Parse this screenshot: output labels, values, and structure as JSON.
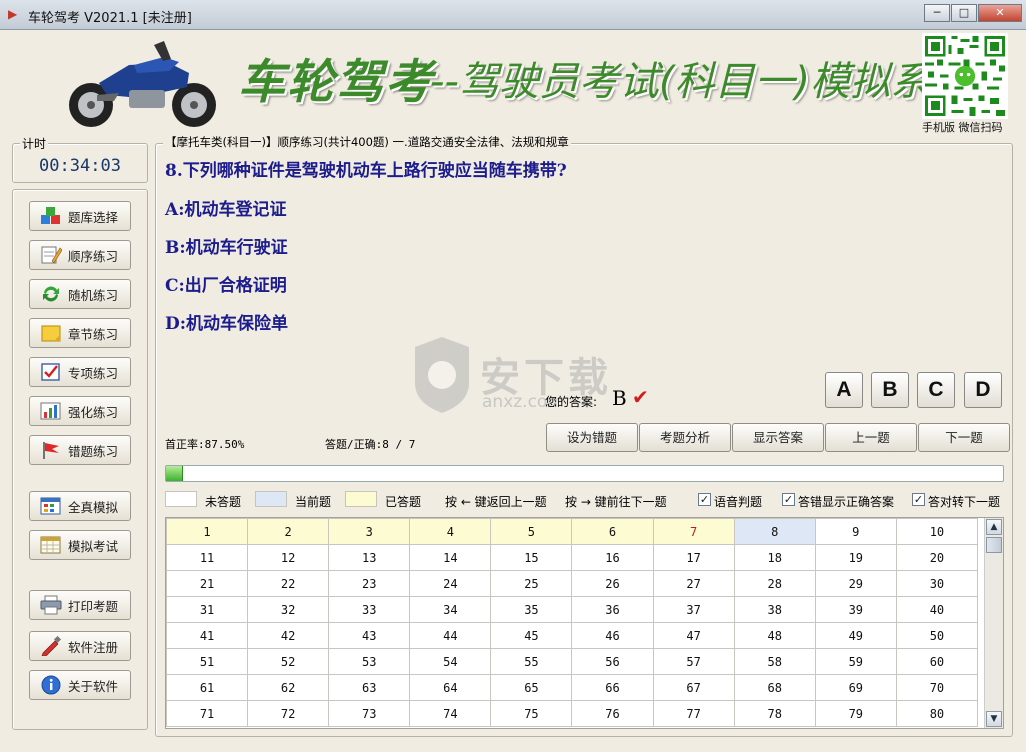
{
  "window": {
    "title": "车轮驾考 V2021.1 [未注册]",
    "controls": [
      "─",
      "□",
      "✕"
    ]
  },
  "banner": {
    "brand": "车轮驾考",
    "subtitle": "--驾驶员考试(科目一)模拟系统",
    "qr_caption": "手机版 微信扫码"
  },
  "timer": {
    "label": "计时",
    "value": "00:34:03"
  },
  "sidebar": {
    "items": [
      {
        "label": "题库选择",
        "icon": "cubes-icon"
      },
      {
        "label": "顺序练习",
        "icon": "pencil-note-icon"
      },
      {
        "label": "随机练习",
        "icon": "refresh-arrows-icon"
      },
      {
        "label": "章节练习",
        "icon": "folder-note-icon"
      },
      {
        "label": "专项练习",
        "icon": "checkbox-icon"
      },
      {
        "label": "强化练习",
        "icon": "bar-chart-icon"
      },
      {
        "label": "错题练习",
        "icon": "red-flag-icon"
      },
      {
        "label": "全真模拟",
        "icon": "window-grid-icon"
      },
      {
        "label": "模拟考试",
        "icon": "calendar-grid-icon"
      },
      {
        "label": "打印考题",
        "icon": "printer-icon"
      },
      {
        "label": "软件注册",
        "icon": "tool-pen-icon"
      },
      {
        "label": "关于软件",
        "icon": "info-icon"
      }
    ]
  },
  "exam": {
    "breadcrumb": "【摩托车类(科目一)】顺序练习(共计400题) 一.道路交通安全法律、法规和规章",
    "question": "8.下列哪种证件是驾驶机动车上路行驶应当随车携带?",
    "options": [
      "A:机动车登记证",
      "B:机动车行驶证",
      "C:出厂合格证明",
      "D:机动车保险单"
    ],
    "your_answer_label": "您的答案:",
    "your_answer": "B",
    "check_mark": "✔",
    "answer_buttons": [
      "A",
      "B",
      "C",
      "D"
    ],
    "first_correct_rate": "首正率:87.50%",
    "answered_correct": "答题/正确:8 / 7",
    "actions": [
      "设为错题",
      "考题分析",
      "显示答案",
      "上一题",
      "下一题"
    ],
    "progress": 0.02
  },
  "watermark": {
    "text": "安下载",
    "sub": "anxz.com"
  },
  "legend": {
    "unanswered": "未答题",
    "current": "当前题",
    "answered": "已答题",
    "hint_back": "按 ← 键返回上一题",
    "hint_next": "按 → 键前往下一题",
    "options": [
      {
        "label": "语音判题",
        "checked": true
      },
      {
        "label": "答错显示正确答案",
        "checked": true
      },
      {
        "label": "答对转下一题",
        "checked": true
      }
    ]
  },
  "grid": {
    "rows": [
      [
        "1",
        "2",
        "3",
        "4",
        "5",
        "6",
        "7",
        "8",
        "9",
        "10"
      ],
      [
        "11",
        "12",
        "13",
        "14",
        "15",
        "16",
        "17",
        "18",
        "19",
        "20"
      ],
      [
        "21",
        "22",
        "23",
        "24",
        "25",
        "26",
        "27",
        "28",
        "29",
        "30"
      ],
      [
        "31",
        "32",
        "33",
        "34",
        "35",
        "36",
        "37",
        "38",
        "39",
        "40"
      ],
      [
        "41",
        "42",
        "43",
        "44",
        "45",
        "46",
        "47",
        "48",
        "49",
        "50"
      ],
      [
        "51",
        "52",
        "53",
        "54",
        "55",
        "56",
        "57",
        "58",
        "59",
        "60"
      ],
      [
        "61",
        "62",
        "63",
        "64",
        "65",
        "66",
        "67",
        "68",
        "69",
        "70"
      ],
      [
        "71",
        "72",
        "73",
        "74",
        "75",
        "76",
        "77",
        "78",
        "79",
        "80"
      ]
    ],
    "answered": [
      1,
      2,
      3,
      4,
      5,
      6,
      7
    ],
    "wrong": [
      7
    ],
    "current": 8
  },
  "colors": {
    "accent_green": "#3d8a2b",
    "question_text": "#1c1c8c",
    "answered_cell": "#fdfbd2",
    "current_cell": "#dde7f6",
    "wrong_text": "#c81919"
  }
}
